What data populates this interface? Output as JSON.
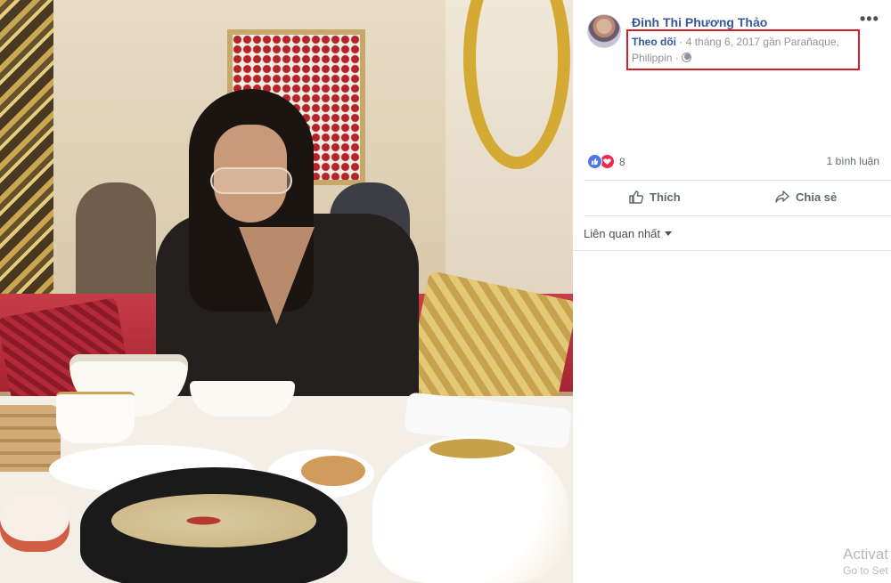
{
  "post": {
    "author_name": "Đinh Thi Phương Thảo",
    "follow_label": "Theo dõi",
    "separator": "·",
    "date_location": "4 tháng 6, 2017 gần Parañaque,",
    "location_line2": "Philippin",
    "privacy_icon": "globe-icon",
    "more_label": "•••"
  },
  "stats": {
    "reaction_icons": [
      "like-icon",
      "love-icon"
    ],
    "reaction_count": "8",
    "comment_count": "1 bình luận"
  },
  "actions": {
    "like_label": "Thích",
    "share_label": "Chia sẻ"
  },
  "comments": {
    "sort_label": "Liên quan nhất"
  },
  "watermark": {
    "line1": "Activat",
    "line2": "Go to Set"
  },
  "colors": {
    "link_blue": "#365899",
    "like_blue": "#4a76e8",
    "love_red": "#f0284a",
    "highlight_red": "#d42027",
    "secondary_text": "#606770"
  }
}
